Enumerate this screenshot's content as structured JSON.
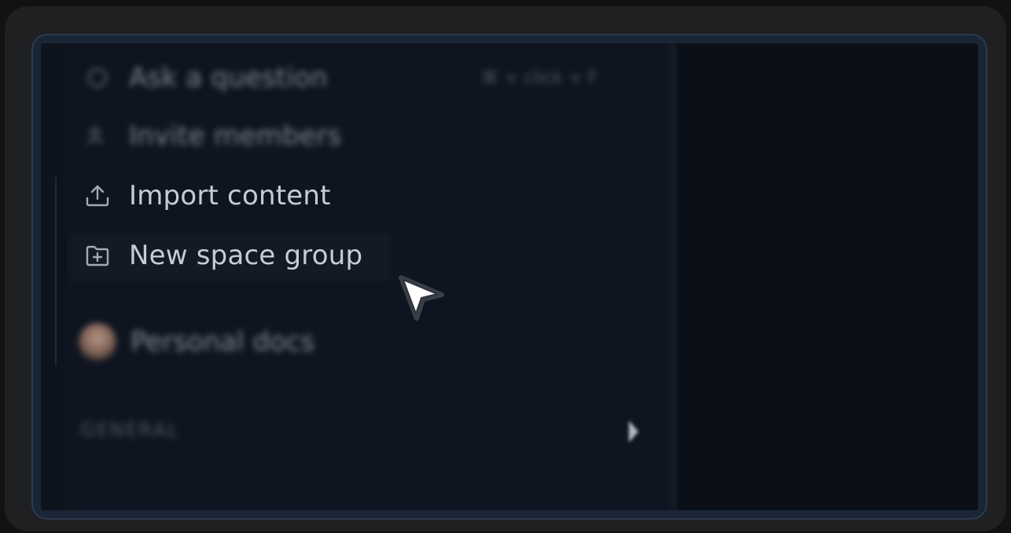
{
  "menu": {
    "ask_label": "Ask a question",
    "ask_shortcut": "⌘ + click + F",
    "invite_label": "Invite members",
    "import_label": "Import content",
    "new_group_label": "New space group"
  },
  "personal": {
    "label": "Personal docs"
  },
  "section": {
    "label": "GENERAL"
  },
  "icons": {
    "ask": "question-icon",
    "invite": "users-icon",
    "import": "upload-icon",
    "new_group": "folder-plus-icon",
    "chevron": "chevron-right-icon",
    "cursor": "pointer-cursor-icon"
  },
  "colors": {
    "background": "#0c1119",
    "sidebar": "#0f1520",
    "frame": "#2a3a52",
    "text": "#c8ccd2"
  }
}
